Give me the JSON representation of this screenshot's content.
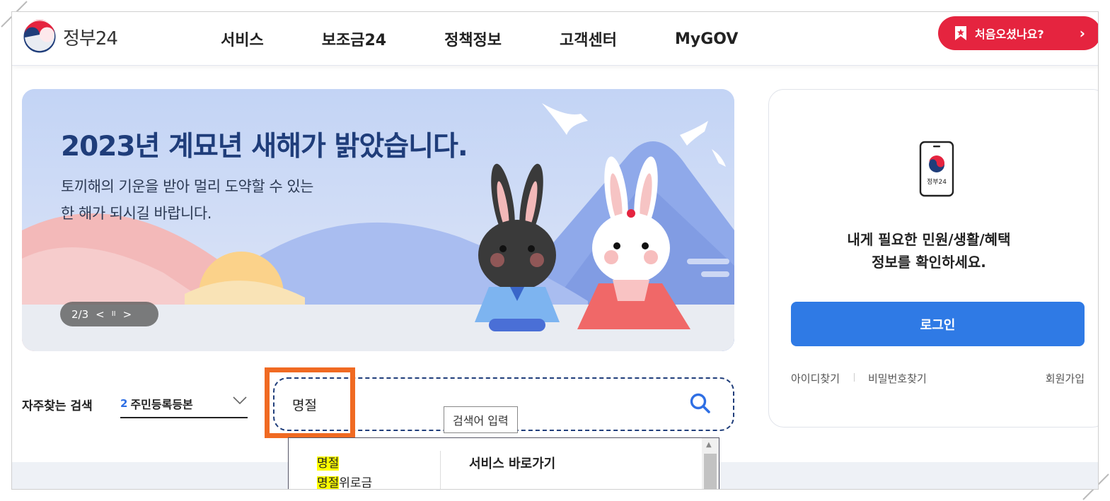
{
  "header": {
    "logo_text": "정부24",
    "nav": [
      "서비스",
      "보조금24",
      "정책정보",
      "고객센터",
      "MyGOV"
    ],
    "first_visit_label": "처음오셨나요?"
  },
  "banner": {
    "title": "2023년 계묘년 새해가 밝았습니다.",
    "subtitle_line1": "토끼해의 기운을 받아 멀리 도약할 수 있는",
    "subtitle_line2": "한 해가 되시길 바랍니다.",
    "counter": "2/3",
    "prev_glyph": "<",
    "pause_glyph": "II",
    "next_glyph": ">"
  },
  "frequent_search": {
    "label": "자주찾는 검색",
    "rank": "2",
    "term": "주민등록등본"
  },
  "search": {
    "value": "명절",
    "tooltip": "검색어 입력"
  },
  "autocomplete": {
    "items": [
      {
        "match": "명절",
        "rest": ""
      },
      {
        "match": "명절",
        "rest": "위로금"
      }
    ],
    "shortcut_heading": "서비스 바로가기"
  },
  "login_card": {
    "icon_caption": "정부24",
    "message_line1": "내게 필요한 민원/생활/혜택",
    "message_line2": "정보를 확인하세요.",
    "login_button": "로그인",
    "find_id": "아이디찾기",
    "find_password": "비밀번호찾기",
    "signup": "회원가입"
  },
  "colors": {
    "accent_red": "#e5243f",
    "login_blue": "#2f7ae5",
    "banner_title": "#1f3d7a",
    "highlight_orange": "#f06a22"
  },
  "icons": [
    "gov-logo-icon",
    "bookmark-star-icon",
    "chevron-right-icon",
    "chevron-down-icon",
    "search-icon",
    "phone-logo-icon",
    "rabbit-illustration"
  ]
}
